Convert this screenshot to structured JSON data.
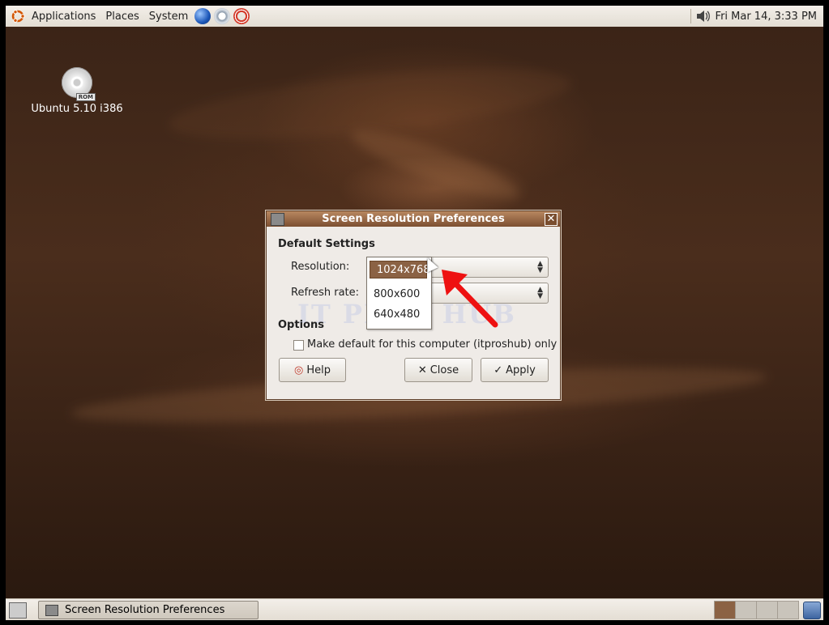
{
  "top_panel": {
    "menus": [
      "Applications",
      "Places",
      "System"
    ],
    "clock": "Fri Mar 14,  3:33 PM",
    "icons": [
      "ubuntu-logo-icon",
      "globe-icon",
      "clock-icon",
      "help-lifering-icon",
      "volume-icon"
    ]
  },
  "desktop": {
    "icon_label": "Ubuntu 5.10 i386",
    "icon_badge": "ROM"
  },
  "dialog": {
    "title": "Screen Resolution Preferences",
    "section_default": "Default Settings",
    "resolution_label": "Resolution:",
    "refresh_label": "Refresh rate:",
    "section_options": "Options",
    "checkbox_label": "Make default for this computer (itproshub) only",
    "checkbox_checked": false,
    "buttons": {
      "help": "Help",
      "close": "Close",
      "apply": "Apply"
    },
    "watermark": "IT PROS HUB"
  },
  "dropdown": {
    "options": [
      "1024x768",
      "800x600",
      "640x480"
    ],
    "selected": "1024x768"
  },
  "bottom_panel": {
    "task_label": "Screen Resolution Preferences",
    "workspaces": 4,
    "active_workspace": 1
  },
  "colors": {
    "accent_brown": "#8b6244",
    "arrow_red": "#ee1111",
    "titlebar": "#7c4f31"
  }
}
